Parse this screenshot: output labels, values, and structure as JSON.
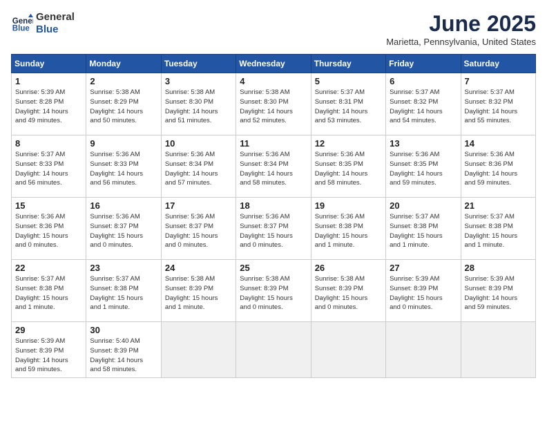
{
  "header": {
    "logo_line1": "General",
    "logo_line2": "Blue",
    "month": "June 2025",
    "location": "Marietta, Pennsylvania, United States"
  },
  "weekdays": [
    "Sunday",
    "Monday",
    "Tuesday",
    "Wednesday",
    "Thursday",
    "Friday",
    "Saturday"
  ],
  "weeks": [
    [
      {
        "day": "1",
        "info": "Sunrise: 5:39 AM\nSunset: 8:28 PM\nDaylight: 14 hours\nand 49 minutes."
      },
      {
        "day": "2",
        "info": "Sunrise: 5:38 AM\nSunset: 8:29 PM\nDaylight: 14 hours\nand 50 minutes."
      },
      {
        "day": "3",
        "info": "Sunrise: 5:38 AM\nSunset: 8:30 PM\nDaylight: 14 hours\nand 51 minutes."
      },
      {
        "day": "4",
        "info": "Sunrise: 5:38 AM\nSunset: 8:30 PM\nDaylight: 14 hours\nand 52 minutes."
      },
      {
        "day": "5",
        "info": "Sunrise: 5:37 AM\nSunset: 8:31 PM\nDaylight: 14 hours\nand 53 minutes."
      },
      {
        "day": "6",
        "info": "Sunrise: 5:37 AM\nSunset: 8:32 PM\nDaylight: 14 hours\nand 54 minutes."
      },
      {
        "day": "7",
        "info": "Sunrise: 5:37 AM\nSunset: 8:32 PM\nDaylight: 14 hours\nand 55 minutes."
      }
    ],
    [
      {
        "day": "8",
        "info": "Sunrise: 5:37 AM\nSunset: 8:33 PM\nDaylight: 14 hours\nand 56 minutes."
      },
      {
        "day": "9",
        "info": "Sunrise: 5:36 AM\nSunset: 8:33 PM\nDaylight: 14 hours\nand 56 minutes."
      },
      {
        "day": "10",
        "info": "Sunrise: 5:36 AM\nSunset: 8:34 PM\nDaylight: 14 hours\nand 57 minutes."
      },
      {
        "day": "11",
        "info": "Sunrise: 5:36 AM\nSunset: 8:34 PM\nDaylight: 14 hours\nand 58 minutes."
      },
      {
        "day": "12",
        "info": "Sunrise: 5:36 AM\nSunset: 8:35 PM\nDaylight: 14 hours\nand 58 minutes."
      },
      {
        "day": "13",
        "info": "Sunrise: 5:36 AM\nSunset: 8:35 PM\nDaylight: 14 hours\nand 59 minutes."
      },
      {
        "day": "14",
        "info": "Sunrise: 5:36 AM\nSunset: 8:36 PM\nDaylight: 14 hours\nand 59 minutes."
      }
    ],
    [
      {
        "day": "15",
        "info": "Sunrise: 5:36 AM\nSunset: 8:36 PM\nDaylight: 15 hours\nand 0 minutes."
      },
      {
        "day": "16",
        "info": "Sunrise: 5:36 AM\nSunset: 8:37 PM\nDaylight: 15 hours\nand 0 minutes."
      },
      {
        "day": "17",
        "info": "Sunrise: 5:36 AM\nSunset: 8:37 PM\nDaylight: 15 hours\nand 0 minutes."
      },
      {
        "day": "18",
        "info": "Sunrise: 5:36 AM\nSunset: 8:37 PM\nDaylight: 15 hours\nand 0 minutes."
      },
      {
        "day": "19",
        "info": "Sunrise: 5:36 AM\nSunset: 8:38 PM\nDaylight: 15 hours\nand 1 minute."
      },
      {
        "day": "20",
        "info": "Sunrise: 5:37 AM\nSunset: 8:38 PM\nDaylight: 15 hours\nand 1 minute."
      },
      {
        "day": "21",
        "info": "Sunrise: 5:37 AM\nSunset: 8:38 PM\nDaylight: 15 hours\nand 1 minute."
      }
    ],
    [
      {
        "day": "22",
        "info": "Sunrise: 5:37 AM\nSunset: 8:38 PM\nDaylight: 15 hours\nand 1 minute."
      },
      {
        "day": "23",
        "info": "Sunrise: 5:37 AM\nSunset: 8:38 PM\nDaylight: 15 hours\nand 1 minute."
      },
      {
        "day": "24",
        "info": "Sunrise: 5:38 AM\nSunset: 8:39 PM\nDaylight: 15 hours\nand 1 minute."
      },
      {
        "day": "25",
        "info": "Sunrise: 5:38 AM\nSunset: 8:39 PM\nDaylight: 15 hours\nand 0 minutes."
      },
      {
        "day": "26",
        "info": "Sunrise: 5:38 AM\nSunset: 8:39 PM\nDaylight: 15 hours\nand 0 minutes."
      },
      {
        "day": "27",
        "info": "Sunrise: 5:39 AM\nSunset: 8:39 PM\nDaylight: 15 hours\nand 0 minutes."
      },
      {
        "day": "28",
        "info": "Sunrise: 5:39 AM\nSunset: 8:39 PM\nDaylight: 14 hours\nand 59 minutes."
      }
    ],
    [
      {
        "day": "29",
        "info": "Sunrise: 5:39 AM\nSunset: 8:39 PM\nDaylight: 14 hours\nand 59 minutes."
      },
      {
        "day": "30",
        "info": "Sunrise: 5:40 AM\nSunset: 8:39 PM\nDaylight: 14 hours\nand 58 minutes."
      },
      {
        "day": "",
        "info": ""
      },
      {
        "day": "",
        "info": ""
      },
      {
        "day": "",
        "info": ""
      },
      {
        "day": "",
        "info": ""
      },
      {
        "day": "",
        "info": ""
      }
    ]
  ]
}
